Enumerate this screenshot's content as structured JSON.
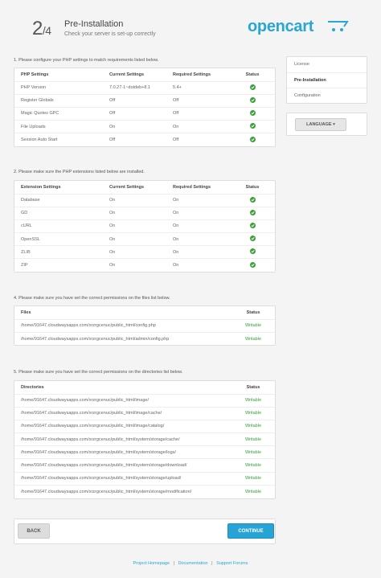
{
  "header": {
    "step_current": "2",
    "step_total": "4",
    "title": "Pre-Installation",
    "subtitle": "Check your server is set-up correctly",
    "logo_text": "opencart"
  },
  "sections": {
    "php": {
      "label": "1. Please configure your PHP settings to match requirements listed below.",
      "columns": [
        "PHP Settings",
        "Current Settings",
        "Required Settings",
        "Status"
      ],
      "rows": [
        [
          "PHP Version",
          "7.0.27-1~dotdeb+8.1",
          "5.4+"
        ],
        [
          "Register Globals",
          "Off",
          "Off"
        ],
        [
          "Magic Quotes GPC",
          "Off",
          "Off"
        ],
        [
          "File Uploads",
          "On",
          "On"
        ],
        [
          "Session Auto Start",
          "Off",
          "Off"
        ]
      ]
    },
    "extensions": {
      "label": "2. Please make sure the PHP extensions listed below are installed.",
      "columns": [
        "Extension Settings",
        "Current Settings",
        "Required Settings",
        "Status"
      ],
      "rows": [
        [
          "Database",
          "On",
          "On"
        ],
        [
          "GD",
          "On",
          "On"
        ],
        [
          "cURL",
          "On",
          "On"
        ],
        [
          "OpenSSL",
          "On",
          "On"
        ],
        [
          "ZLIB",
          "On",
          "On"
        ],
        [
          "ZIP",
          "On",
          "On"
        ]
      ]
    },
    "files": {
      "label": "4. Please make sure you have set the correct permissions on the files list below.",
      "columns": [
        "Files",
        "Status"
      ],
      "rows": [
        [
          "/home/91647.cloudwaysapps.com/xrzrgcenuc/public_html/config.php",
          "Writable"
        ],
        [
          "/home/91647.cloudwaysapps.com/xrzrgcenuc/public_html/admin/config.php",
          "Writable"
        ]
      ]
    },
    "directories": {
      "label": "5. Please make sure you have set the correct permissions on the directories list below.",
      "columns": [
        "Directories",
        "Status"
      ],
      "rows": [
        [
          "/home/91647.cloudwaysapps.com/xrzrgcenuc/public_html/image/",
          "Writable"
        ],
        [
          "/home/91647.cloudwaysapps.com/xrzrgcenuc/public_html/image/cache/",
          "Writable"
        ],
        [
          "/home/91647.cloudwaysapps.com/xrzrgcenuc/public_html/image/catalog/",
          "Writable"
        ],
        [
          "/home/91647.cloudwaysapps.com/xrzrgcenuc/public_html/system/storage/cache/",
          "Writable"
        ],
        [
          "/home/91647.cloudwaysapps.com/xrzrgcenuc/public_html/system/storage/logs/",
          "Writable"
        ],
        [
          "/home/91647.cloudwaysapps.com/xrzrgcenuc/public_html/system/storage/download/",
          "Writable"
        ],
        [
          "/home/91647.cloudwaysapps.com/xrzrgcenuc/public_html/system/storage/upload/",
          "Writable"
        ],
        [
          "/home/91647.cloudwaysapps.com/xrzrgcenuc/public_html/system/storage/modification/",
          "Writable"
        ]
      ]
    }
  },
  "status_icon": "check-circle-icon",
  "colors": {
    "accent": "#27a3d6",
    "ok": "#3aa03a"
  },
  "sidebar": {
    "items": [
      {
        "label": "License"
      },
      {
        "label": "Pre-Installation",
        "active": true
      },
      {
        "label": "Configuration"
      }
    ],
    "language_label": "LANGUAGE",
    "language_caret": "▾"
  },
  "buttons": {
    "back": "BACK",
    "continue": "CONTINUE"
  },
  "footer": {
    "links": [
      "Project Homepage",
      "Documentation",
      "Support Forums"
    ],
    "separator": "|"
  }
}
